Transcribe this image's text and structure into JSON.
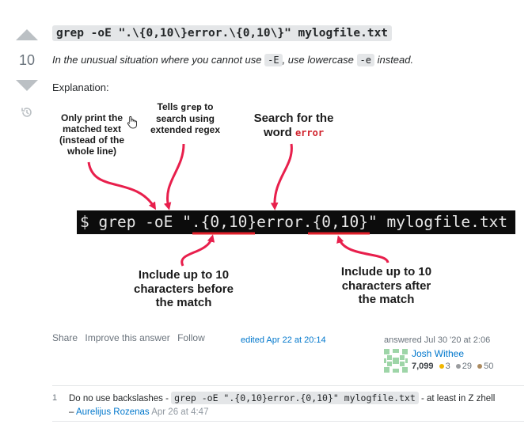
{
  "vote": {
    "count": "10"
  },
  "answer": {
    "title_code": "grep -oE \".\\{0,10\\}error.\\{0,10\\}\" mylogfile.txt",
    "intro_1": "In the unusual situation where you cannot use ",
    "intro_code_1": "-E",
    "intro_2": ", use lowercase ",
    "intro_code_2": "-e",
    "intro_3": " instead.",
    "explanation_label": "Explanation:"
  },
  "diagram": {
    "ann_only_print": [
      "Only print the",
      "matched text",
      "(instead of the",
      "whole line)"
    ],
    "ann_tells_1": "Tells ",
    "ann_tells_code": "grep",
    "ann_tells_2": " to",
    "ann_tells_rest": [
      "search using",
      "extended regex"
    ],
    "ann_search": [
      "Search for the",
      "word "
    ],
    "ann_search_code": "error",
    "ann_before": [
      "Include up to 10",
      "characters before",
      "the match"
    ],
    "ann_after": [
      "Include up to 10",
      "characters after",
      "the match"
    ],
    "cmd_prefix": "$ grep -oE \"",
    "cmd_pat1": ".{0,10}",
    "cmd_mid": "error",
    "cmd_pat2": ".{0,10}",
    "cmd_suffix": "\" mylogfile.txt",
    "colors": {
      "arrow": "#e81f4c",
      "underline": "#e0202a",
      "cmd_bg": "#0c0c0c"
    }
  },
  "post_menu": {
    "share": "Share",
    "improve": "Improve this answer",
    "follow": "Follow"
  },
  "edited": "edited Apr 22 at 20:14",
  "author": {
    "answered": "answered Jul 30 '20 at 2:06",
    "name": "Josh Withee",
    "reputation": "7,099",
    "gold": "3",
    "silver": "29",
    "bronze": "50"
  },
  "comment": {
    "score": "1",
    "text_1": "Do no use backslashes - ",
    "code": "grep -oE \".{0,10}error.{0,10}\" mylogfile.txt",
    "text_2": " - at least in Z zhell",
    "dash": "– ",
    "user": "Aurelijus Rozenas",
    "date": "Apr 26 at 4:47"
  }
}
